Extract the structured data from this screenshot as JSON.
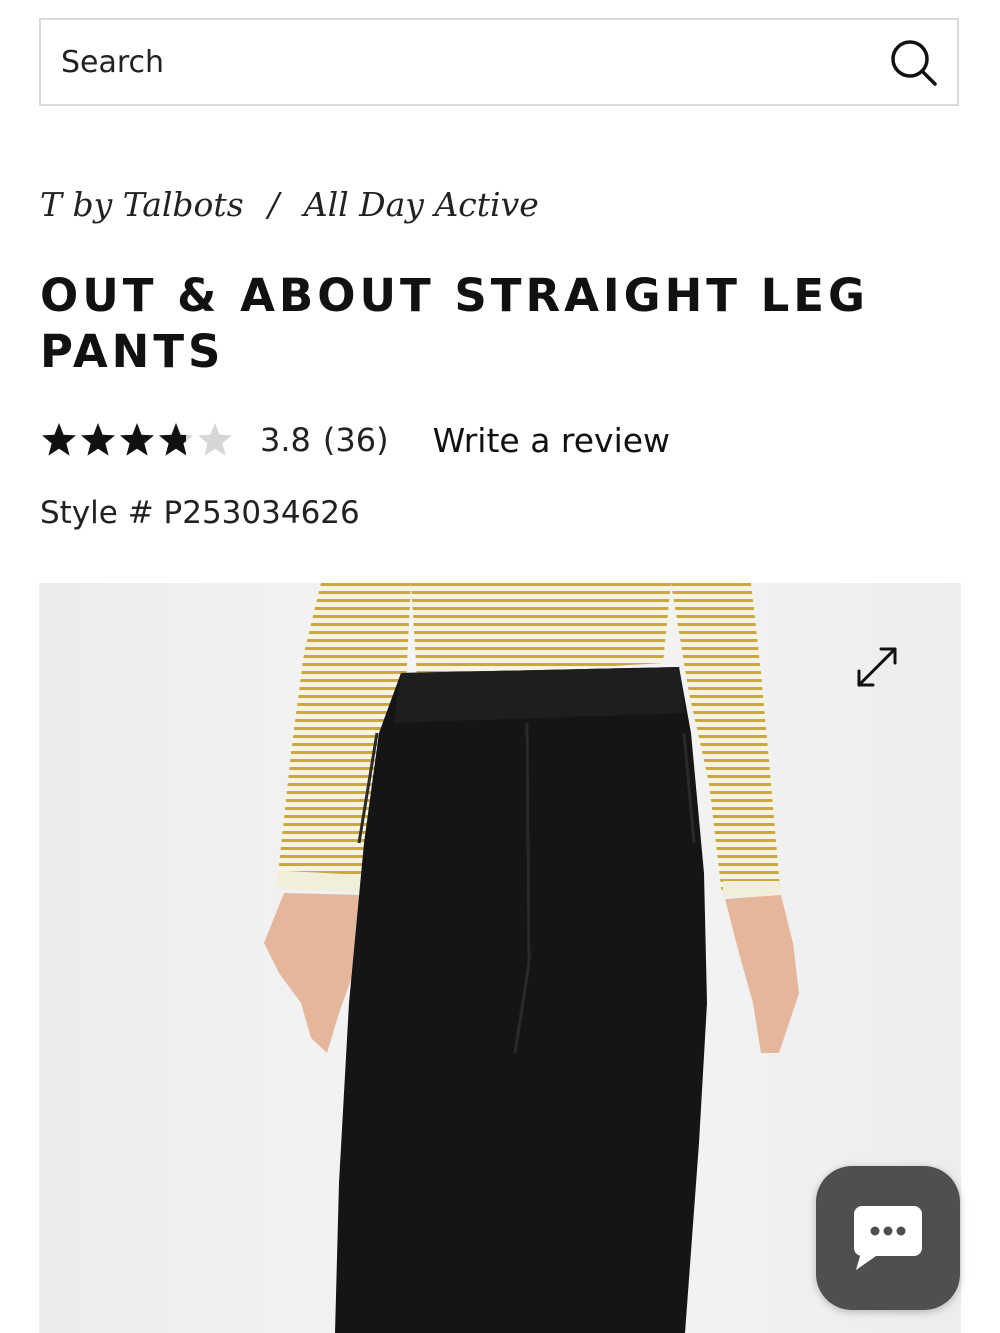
{
  "search": {
    "placeholder": "Search",
    "icon": "search-icon"
  },
  "breadcrumb": [
    {
      "label": "T by Talbots"
    },
    {
      "separator": "/"
    },
    {
      "label": "All Day Active"
    }
  ],
  "product": {
    "title": "OUT & ABOUT STRAIGHT LEG PANTS",
    "rating": {
      "value": "3.8",
      "count": "(36)",
      "stars_filled": 3.8,
      "stars_total": 5
    },
    "write_review_label": "Write a review",
    "style_number": "Style # P253034626"
  },
  "image": {
    "description_icon": "expand-icon"
  },
  "chat": {
    "icon": "chat-bubble-icon"
  },
  "colors": {
    "text": "#111111",
    "border": "#d9d9d9",
    "star_filled": "#111111",
    "star_empty": "#d6d6d6",
    "chat_bg": "#4f4f4f"
  }
}
